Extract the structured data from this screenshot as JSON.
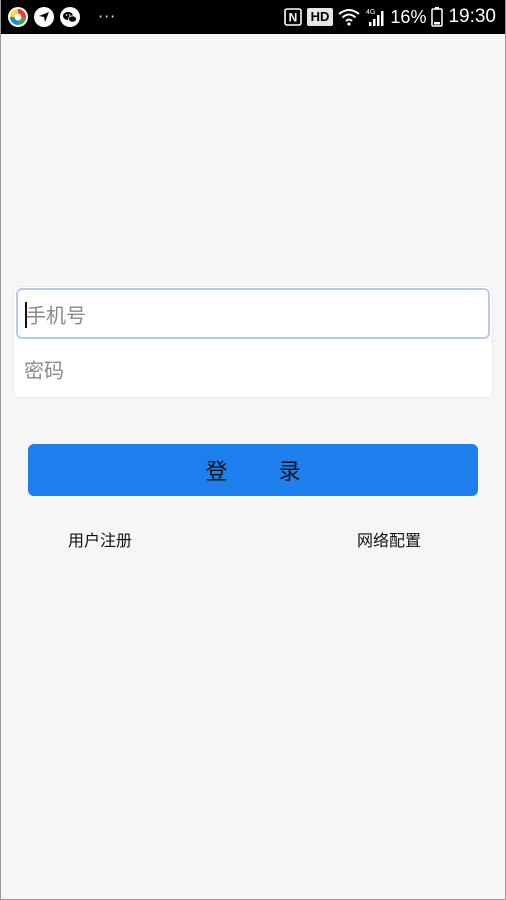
{
  "status_bar": {
    "notification_icons": [
      "colorful-app-icon",
      "direction-icon",
      "wechat-icon"
    ],
    "overflow": "···",
    "nfc_label": "N",
    "hd_label": "HD",
    "network_label": "4G",
    "battery_percent": "16%",
    "time": "19:30"
  },
  "login_form": {
    "phone_placeholder": "手机号",
    "password_placeholder": "密码",
    "login_button_label": "登 录",
    "register_link": "用户注册",
    "network_config_link": "网络配置"
  },
  "colors": {
    "primary": "#1d80ee",
    "background": "#f6f6f6",
    "focus_border": "#b6cbe6"
  }
}
